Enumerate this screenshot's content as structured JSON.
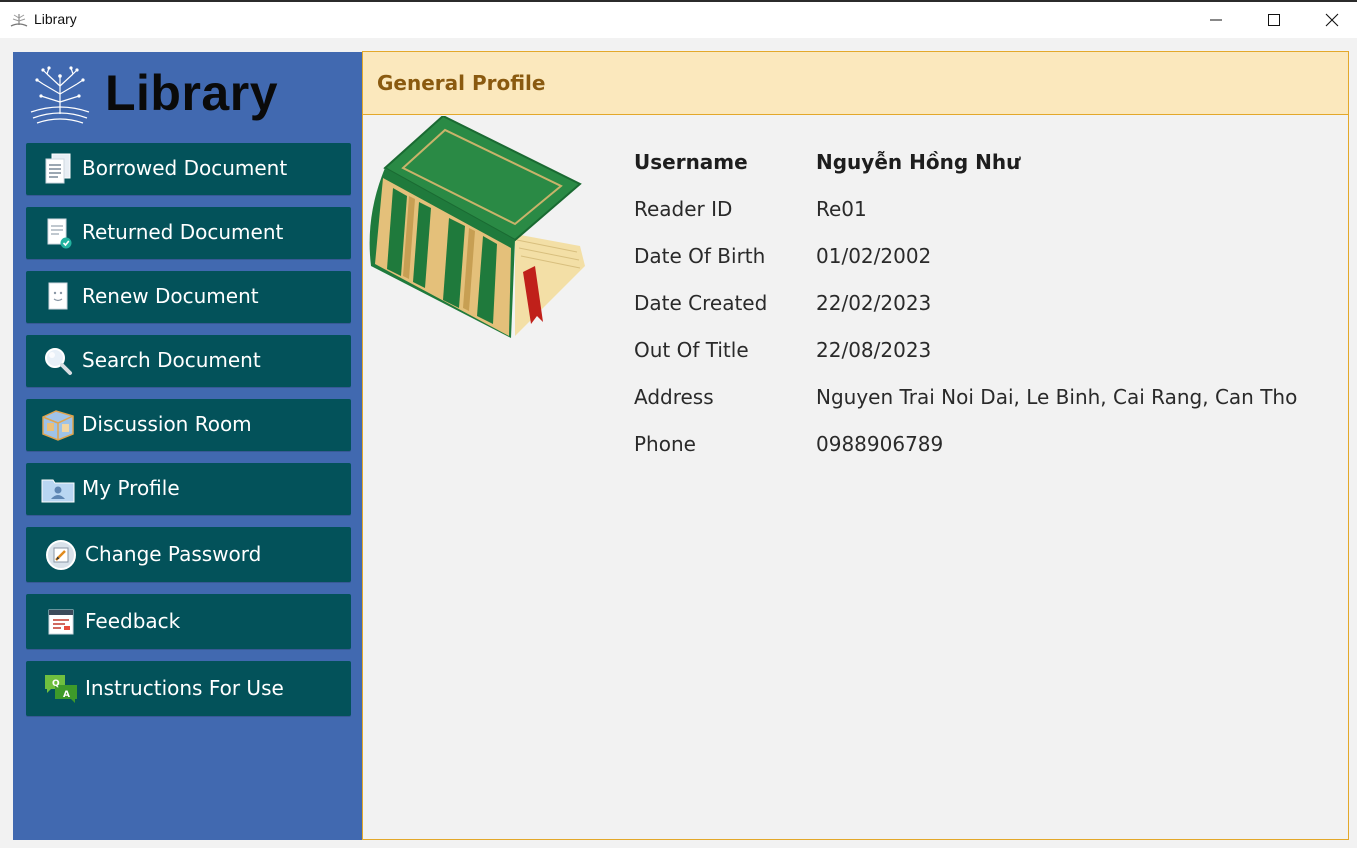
{
  "window": {
    "title": "Library",
    "icon": "library-tree-icon"
  },
  "sidebar": {
    "brand": "Library",
    "logo_icon": "library-tree-logo-icon",
    "bg_color": "#4169b0",
    "button_color": "#03525a",
    "items": [
      {
        "label": "Borrowed Document",
        "icon": "document-stack-icon"
      },
      {
        "label": "Returned Document",
        "icon": "document-check-icon"
      },
      {
        "label": "Renew Document",
        "icon": "document-face-icon"
      },
      {
        "label": "Search Document",
        "icon": "magnifier-icon"
      },
      {
        "label": "Discussion Room",
        "icon": "room-cube-icon"
      },
      {
        "label": "My Profile",
        "icon": "profile-folder-icon"
      },
      {
        "label": "Change Password",
        "icon": "password-edit-icon"
      },
      {
        "label": "Feedback",
        "icon": "feedback-form-icon"
      },
      {
        "label": "Instructions For Use",
        "icon": "qa-chat-icon"
      }
    ]
  },
  "main": {
    "header_title": "General Profile",
    "header_color": "#fbe8bd",
    "border_color": "#e3a82a",
    "image_icon": "green-book-icon",
    "profile": [
      {
        "label": "Username",
        "value": "Nguyễn Hồng Như"
      },
      {
        "label": "Reader ID",
        "value": "Re01"
      },
      {
        "label": "Date Of Birth",
        "value": "01/02/2002"
      },
      {
        "label": "Date Created",
        "value": "22/02/2023"
      },
      {
        "label": "Out Of Title",
        "value": "22/08/2023"
      },
      {
        "label": "Address",
        "value": "Nguyen Trai Noi Dai, Le Binh, Cai Rang, Can Tho"
      },
      {
        "label": "Phone",
        "value": "0988906789"
      }
    ]
  }
}
